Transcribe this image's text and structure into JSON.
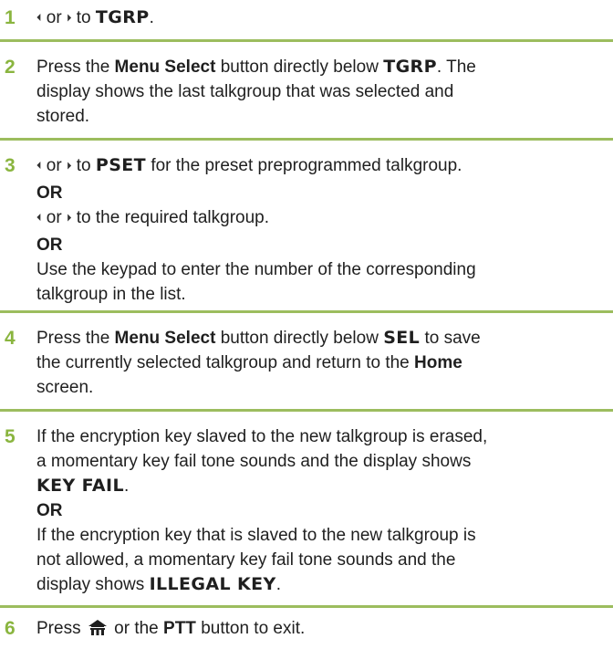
{
  "arrows": {
    "left": "⏴",
    "right": "⏵"
  },
  "steps": [
    {
      "number": "1",
      "or": "or",
      "to": "to",
      "target": "TGRP",
      "period": "."
    },
    {
      "number": "2",
      "press": "Press the",
      "button": "Menu Select",
      "below": "button directly below",
      "target": "TGRP",
      "rest1": ". The",
      "line2": "display shows the last talkgroup that was selected and",
      "line3": "stored."
    },
    {
      "number": "3",
      "or": "or",
      "to": "to",
      "target": "PSET",
      "rest1": "for the preset preprogrammed talkgroup.",
      "or_label_1": "OR",
      "line3_rest": "or",
      "line3_to": "to the required talkgroup.",
      "or_label_2": "OR",
      "line5": "Use the keypad to enter the number of the corresponding",
      "line6": "talkgroup in the list."
    },
    {
      "number": "4",
      "press": "Press the",
      "button": "Menu Select",
      "below": "button directly below",
      "target": "SEL",
      "rest1": "to save",
      "line2a": "the currently selected talkgroup and return to the",
      "home": "Home",
      "line3": "screen."
    },
    {
      "number": "5",
      "line1": "If the encryption key slaved to the new talkgroup is erased,",
      "line2": "a momentary key fail tone sounds and the display shows",
      "display1": "KEY FAIL",
      "period": ".",
      "or_label": "OR",
      "line5": "If the encryption key that is slaved to the new talkgroup is",
      "line6": "not allowed, a momentary key fail tone sounds and the",
      "line7a": "display shows",
      "display2": "ILLEGAL KEY",
      "period2": "."
    },
    {
      "number": "6",
      "press": "Press",
      "or_the": "or the",
      "button": "PTT",
      "rest": "button to exit."
    }
  ],
  "colors": {
    "number": "#8ab53f",
    "rule": "#9cbd5e"
  }
}
